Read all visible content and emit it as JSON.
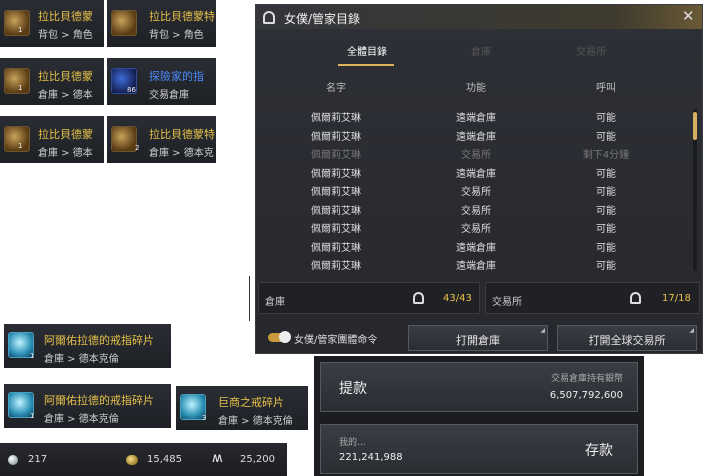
{
  "inventory_slots": [
    {
      "name": "拉比貝德蒙",
      "location": "背包 > 角色",
      "count": "1",
      "name_style": "gold",
      "icon": "key-treasure-icon"
    },
    {
      "name": "拉比貝德蒙特",
      "location": "背包 > 角色",
      "count": "",
      "name_style": "gold",
      "icon": "ring-gear-icon"
    },
    {
      "name": "拉比貝德蒙",
      "location": "倉庫 > 德本",
      "count": "1",
      "name_style": "gold",
      "icon": "telescope-icon"
    },
    {
      "name": "探險家的指",
      "location": "交易倉庫",
      "count": "86",
      "name_style": "blue",
      "icon": "compass-icon"
    },
    {
      "name": "拉比貝德蒙",
      "location": "倉庫 > 德本",
      "count": "1",
      "name_style": "gold",
      "icon": "scroll-icon"
    },
    {
      "name": "拉比貝德蒙特",
      "location": "倉庫 > 德本克",
      "count": "2",
      "name_style": "gold",
      "icon": "key-icon"
    }
  ],
  "fragments": [
    {
      "name": "阿爾佑拉德的戒指碎片",
      "location": "倉庫 > 德本克倫",
      "count": "1"
    },
    {
      "name": "阿爾佑拉德的戒指碎片",
      "location": "倉庫 > 德本克倫",
      "count": "1"
    },
    {
      "name": "巨商之戒碎片",
      "location": "倉庫 > 德本克倫",
      "count": "3"
    }
  ],
  "currency": {
    "pearls": "217",
    "silver": "15,485",
    "energy": "25,200"
  },
  "dialog": {
    "title": "女僕/管家目錄",
    "tabs": [
      "全體目錄",
      "倉庫",
      "交易所"
    ],
    "active_tab": 0,
    "columns": [
      "名字",
      "功能",
      "呼叫"
    ],
    "rows": [
      {
        "name": "佩爾莉艾琳",
        "function": "遠端倉庫",
        "status": "可能",
        "dim": false
      },
      {
        "name": "佩爾莉艾琳",
        "function": "遠端倉庫",
        "status": "可能",
        "dim": false
      },
      {
        "name": "佩爾莉艾琳",
        "function": "交易所",
        "status": "剩下4分鐘",
        "dim": true
      },
      {
        "name": "佩爾莉艾琳",
        "function": "遠端倉庫",
        "status": "可能",
        "dim": false
      },
      {
        "name": "佩爾莉艾琳",
        "function": "交易所",
        "status": "可能",
        "dim": false
      },
      {
        "name": "佩爾莉艾琳",
        "function": "交易所",
        "status": "可能",
        "dim": false
      },
      {
        "name": "佩爾莉艾琳",
        "function": "交易所",
        "status": "可能",
        "dim": false
      },
      {
        "name": "佩爾莉艾琳",
        "function": "遠端倉庫",
        "status": "可能",
        "dim": false
      },
      {
        "name": "佩爾莉艾琳",
        "function": "遠端倉庫",
        "status": "可能",
        "dim": false
      }
    ],
    "warehouse_label": "倉庫",
    "warehouse_count": "43/43",
    "market_label": "交易所",
    "market_count": "17/18",
    "toggle_label": "女僕/管家團體命令",
    "toggle_on": true,
    "open_warehouse": "打開倉庫",
    "open_market": "打開全球交易所"
  },
  "withdraw": {
    "label": "提款",
    "caption": "交易倉庫持有銀幣",
    "amount": "6,507,792,600"
  },
  "deposit": {
    "label": "存款",
    "caption": "我的...",
    "amount": "221,241,988"
  },
  "colors": {
    "gold": "#e7c14a",
    "blue": "#4d8cff",
    "accent_count": "#e8c24a"
  }
}
